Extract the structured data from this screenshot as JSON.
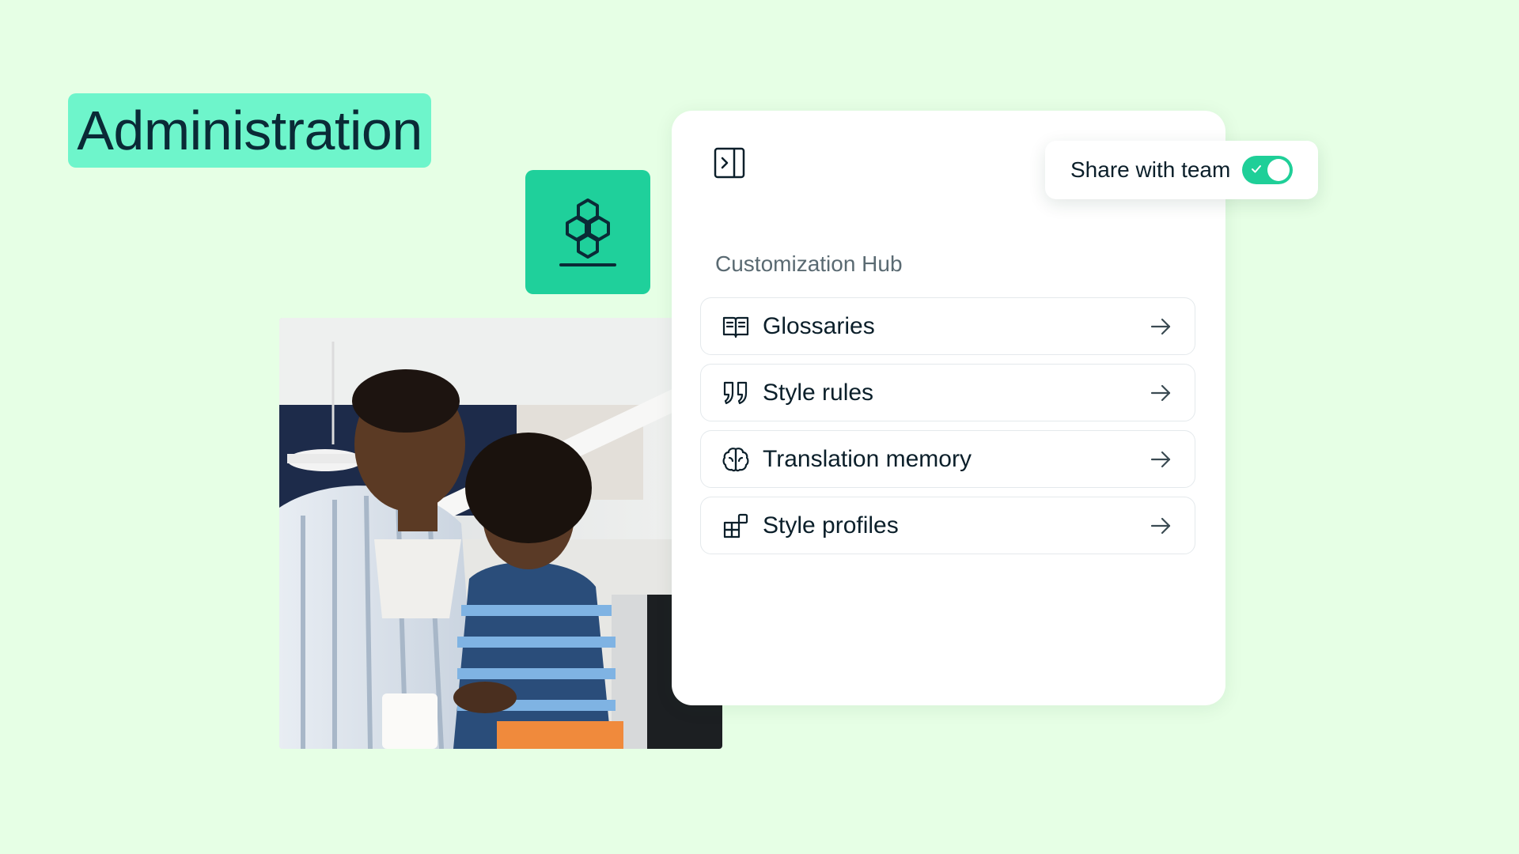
{
  "header": {
    "title": "Administration"
  },
  "panel": {
    "hub_title": "Customization Hub",
    "items": [
      {
        "label": "Glossaries",
        "icon": "book-open-icon"
      },
      {
        "label": "Style rules",
        "icon": "quote-icon"
      },
      {
        "label": "Translation memory",
        "icon": "brain-icon"
      },
      {
        "label": "Style profiles",
        "icon": "blocks-icon"
      }
    ]
  },
  "share": {
    "label": "Share with team",
    "enabled": true
  },
  "colors": {
    "background": "#e6ffe5",
    "badge": "#6ef5cb",
    "accent": "#1fd09b",
    "switch_on": "#1fcf98"
  }
}
